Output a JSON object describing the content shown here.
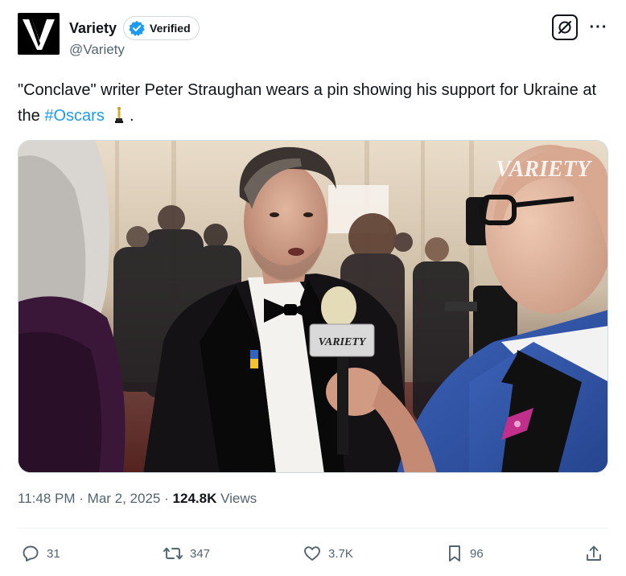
{
  "author": {
    "display_name": "Variety",
    "verified_label": "Verified",
    "handle": "@Variety",
    "avatar_icon": "variety-v-logo-icon"
  },
  "header_actions": {
    "grok_icon": "grok-slash-icon",
    "more_label": "···"
  },
  "tweet": {
    "text_before": "\"Conclave\" writer Peter Straughan wears a pin showing his support for Ukraine at the ",
    "hashtag": "#Oscars",
    "text_after": " .",
    "emoji": "oscar-statuette-icon"
  },
  "media": {
    "watermark": "VARIETY",
    "mic_flag_text": "VARIETY"
  },
  "meta": {
    "time": "11:48 PM",
    "date": "Mar 2, 2025",
    "separator": "·",
    "views_count": "124.8K",
    "views_label": "Views"
  },
  "actions": {
    "replies": "31",
    "reposts": "347",
    "likes": "3.7K",
    "bookmarks": "96"
  },
  "colors": {
    "accent": "#1d9bf0",
    "text": "#0f1419",
    "muted": "#536471",
    "verified_badge": "#1d9bf0"
  }
}
